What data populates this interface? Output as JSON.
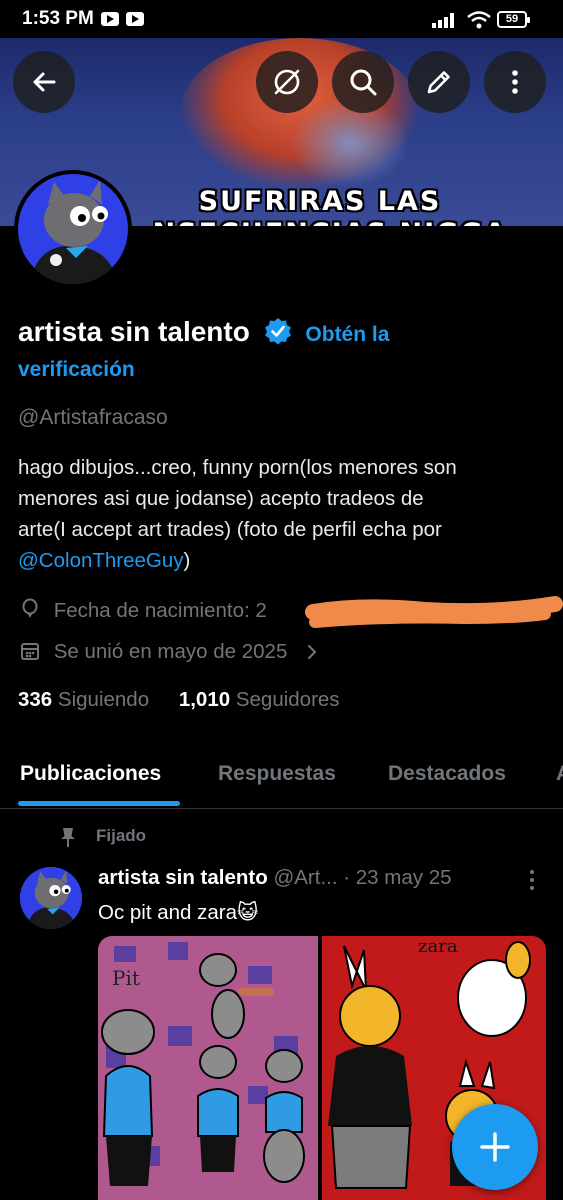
{
  "status_bar": {
    "time": "1:53 PM",
    "battery": "59"
  },
  "banner": {
    "line1": "SUFRIRAS LAS",
    "line2": "NSECUENCIAS NIGGA"
  },
  "profile": {
    "name": "artista sin talento",
    "verify_link_1": "Obtén la",
    "verify_link_2": "verificación",
    "handle": "@Artistafracaso",
    "bio_1": "hago dibujos...creo, funny porn(los menores son",
    "bio_2": "menores asi que jodanse)  acepto tradeos de",
    "bio_3": "arte(I accept art trades) (foto de perfil echa por",
    "bio_mention": "@ColonThreeGuy",
    "bio_end": ")",
    "birthdate_label": "Fecha de nacimiento: 2",
    "joined": "Se unió en mayo de 2025",
    "following_count": "336",
    "following_label": "Siguiendo",
    "followers_count": "1,010",
    "followers_label": "Seguidores"
  },
  "tabs": [
    "Publicaciones",
    "Respuestas",
    "Destacados",
    "A"
  ],
  "post": {
    "pinned_label": "Fijado",
    "author_name": "artista sin talento",
    "author_handle": "@Art...",
    "date": "· 23 may 25",
    "text": "Oc pit and zara😺",
    "img_left_label": "Pit",
    "img_right_label": "zara"
  },
  "colors": {
    "accent": "#1d9bf0",
    "background": "#000000",
    "muted": "#71767b"
  }
}
